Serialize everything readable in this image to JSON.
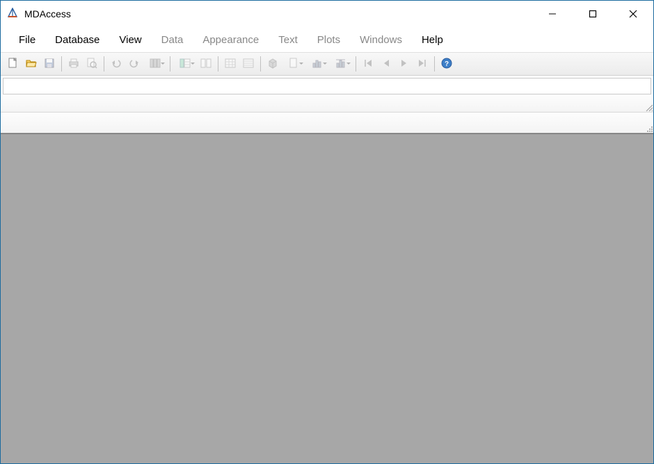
{
  "window": {
    "title": "MDAccess"
  },
  "menu": {
    "items": [
      {
        "label": "File",
        "enabled": true
      },
      {
        "label": "Database",
        "enabled": true
      },
      {
        "label": "View",
        "enabled": true
      },
      {
        "label": "Data",
        "enabled": false
      },
      {
        "label": "Appearance",
        "enabled": false
      },
      {
        "label": "Text",
        "enabled": false
      },
      {
        "label": "Plots",
        "enabled": false
      },
      {
        "label": "Windows",
        "enabled": false
      },
      {
        "label": "Help",
        "enabled": true
      }
    ]
  },
  "toolbar": {
    "new_label": "New",
    "open_label": "Open",
    "save_label": "Save",
    "print_label": "Print",
    "preview_label": "Print Preview",
    "undo_label": "Undo",
    "redo_label": "Redo",
    "columns_label": "Columns",
    "layout_label": "Layout",
    "panes_label": "Panes",
    "grid_label": "Grid",
    "list_label": "List",
    "cube_label": "3D",
    "page_label": "Page",
    "chart1_label": "Chart",
    "chart2_label": "Chart 2",
    "first_label": "First",
    "prev_label": "Previous",
    "next_label": "Next",
    "last_label": "Last",
    "help_label": "Help"
  },
  "input_row": {
    "value": ""
  }
}
